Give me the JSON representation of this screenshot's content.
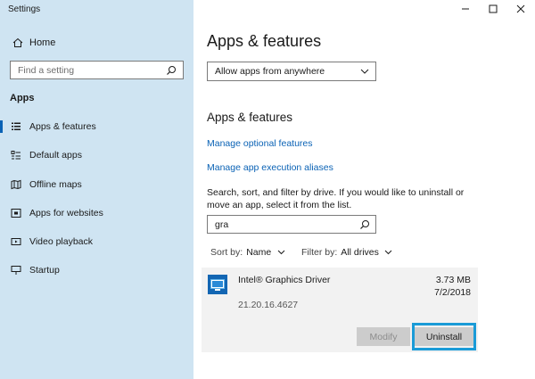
{
  "window": {
    "title": "Settings",
    "controls": [
      "minimize",
      "maximize",
      "close"
    ]
  },
  "sidebar": {
    "home_label": "Home",
    "search_placeholder": "Find a setting",
    "section_header": "Apps",
    "items": [
      {
        "label": "Apps & features",
        "icon": "apps-features-icon",
        "active": true
      },
      {
        "label": "Default apps",
        "icon": "default-apps-icon",
        "active": false
      },
      {
        "label": "Offline maps",
        "icon": "offline-maps-icon",
        "active": false
      },
      {
        "label": "Apps for websites",
        "icon": "apps-websites-icon",
        "active": false
      },
      {
        "label": "Video playback",
        "icon": "video-playback-icon",
        "active": false
      },
      {
        "label": "Startup",
        "icon": "startup-icon",
        "active": false
      }
    ]
  },
  "main": {
    "title": "Apps & features",
    "install_source": "Allow apps from anywhere",
    "section_title": "Apps & features",
    "links": {
      "optional_features": "Manage optional features",
      "execution_aliases": "Manage app execution aliases"
    },
    "description": "Search, sort, and filter by drive. If you would like to uninstall or move an app, select it from the list.",
    "app_search_value": "gra",
    "sort": {
      "label": "Sort by:",
      "value": "Name"
    },
    "filter": {
      "label": "Filter by:",
      "value": "All drives"
    },
    "app": {
      "name": "Intel® Graphics Driver",
      "size": "3.73 MB",
      "date": "7/2/2018",
      "version": "21.20.16.4627",
      "modify_label": "Modify",
      "uninstall_label": "Uninstall"
    }
  },
  "colors": {
    "sidebar_bg": "#cfe4f2",
    "accent": "#0a62b5",
    "focus_ring": "#1a9bd7"
  }
}
